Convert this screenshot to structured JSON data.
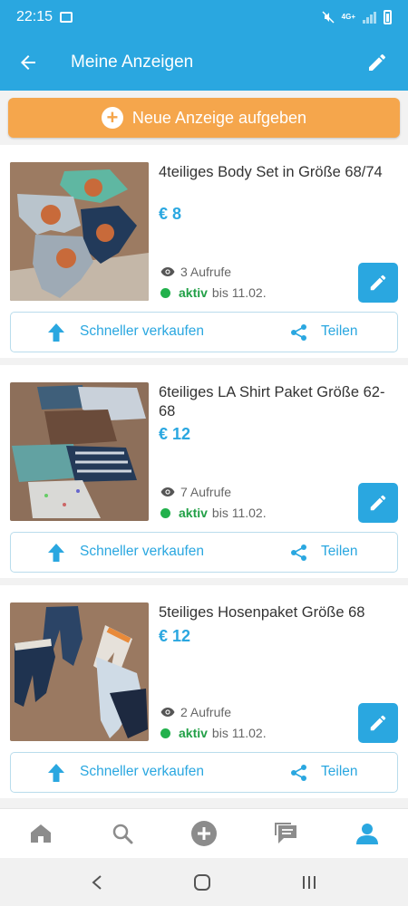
{
  "statusbar": {
    "time": "22:15",
    "network": "4G+"
  },
  "appbar": {
    "title": "Meine Anzeigen"
  },
  "new_ad": {
    "label": "Neue Anzeige aufgeben"
  },
  "ads": [
    {
      "title": "4teiliges Body Set in Größe 68/74",
      "price": "€ 8",
      "views": "3 Aufrufe",
      "status": "aktiv",
      "until": "bis 11.02.",
      "sell_label": "Schneller verkaufen",
      "share_label": "Teilen"
    },
    {
      "title": "6teiliges LA Shirt Paket Größe 62-68",
      "price": "€ 12",
      "views": "7 Aufrufe",
      "status": "aktiv",
      "until": "bis 11.02.",
      "sell_label": "Schneller verkaufen",
      "share_label": "Teilen"
    },
    {
      "title": "5teiliges Hosenpaket Größe 68",
      "price": "€ 12",
      "views": "2 Aufrufe",
      "status": "aktiv",
      "until": "bis 11.02.",
      "sell_label": "Schneller verkaufen",
      "share_label": "Teilen"
    }
  ],
  "bottomnav": {
    "tabs": [
      "home-icon",
      "search-icon",
      "add-icon",
      "messages-icon",
      "profile-icon"
    ],
    "active": "profile-icon"
  },
  "colors": {
    "primary": "#2aa7e0",
    "accent": "#f5a64c",
    "active_green": "#22b14c"
  }
}
